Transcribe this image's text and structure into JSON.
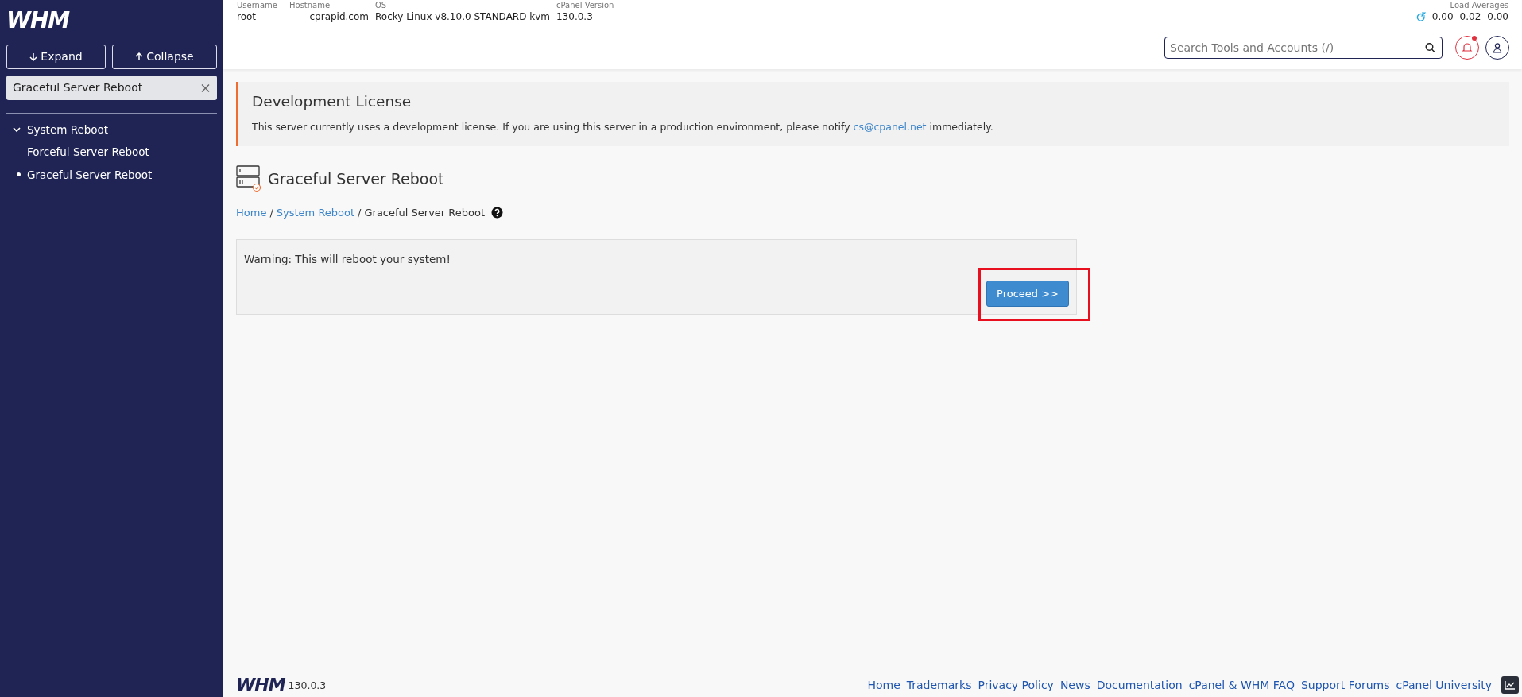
{
  "sidebar": {
    "logo": "WHM",
    "expand_button": "Expand",
    "collapse_button": "Collapse",
    "filter": {
      "value": "Graceful Server Reboot"
    },
    "tree": [
      {
        "label": "System Reboot",
        "expanded": true,
        "children": [
          {
            "label": "Forceful Server Reboot",
            "selected": false
          },
          {
            "label": "Graceful Server Reboot",
            "selected": true
          }
        ]
      }
    ]
  },
  "server_info": [
    {
      "label": "Username",
      "value": "root"
    },
    {
      "label": "Hostname",
      "value": "cprapid.com"
    },
    {
      "label": "OS",
      "value": "Rocky Linux v8.10.0 STANDARD kvm"
    },
    {
      "label": "cPanel Version",
      "value": "130.0.3"
    }
  ],
  "load_averages": {
    "label": "Load Averages",
    "values": [
      "0.00",
      "0.02",
      "0.00"
    ]
  },
  "search": {
    "placeholder": "Search Tools and Accounts (/)"
  },
  "notifications": {
    "unread": true
  },
  "notice": {
    "title": "Development License",
    "text": "This server currently uses a development license. If you are using this server in a production environment, please notify",
    "link": "cs@cpanel.net",
    "text_after": "immediately."
  },
  "page_title": "Graceful Server Reboot",
  "breadcrumb_separator": "/",
  "breadcrumb": [
    {
      "label": "Home",
      "link": true
    },
    {
      "label": "System Reboot",
      "link": true
    },
    {
      "label": "Graceful Server Reboot",
      "link": false
    }
  ],
  "warning": {
    "text": "Warning: This will reboot your system!",
    "button": "Proceed >>",
    "highlighted": true
  },
  "footer": {
    "logo": "WHM",
    "version": "130.0.3",
    "links": [
      "Home",
      "Trademarks",
      "Privacy Policy",
      "News",
      "Documentation",
      "cPanel & WHM FAQ",
      "Support Forums",
      "cPanel University"
    ]
  }
}
